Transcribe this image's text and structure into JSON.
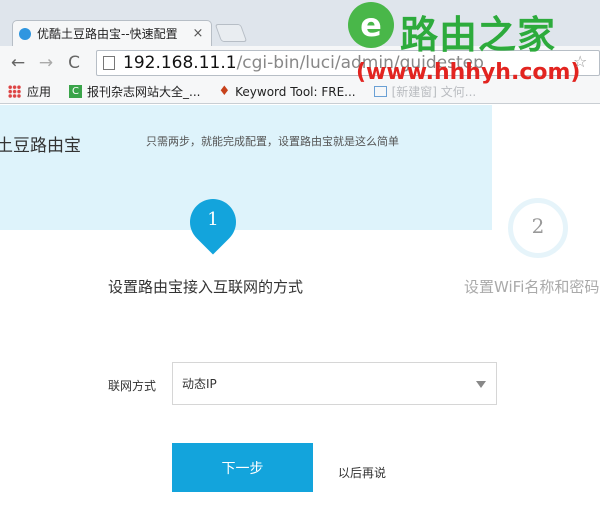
{
  "browser": {
    "tab_title": "优酷土豆路由宝--快速配置",
    "tab_close": "×",
    "address": {
      "host": "192.168.11.1",
      "path": "/cgi-bin/luci/admin/guidestep"
    },
    "nav": {
      "back": "←",
      "forward": "→",
      "reload": "C"
    },
    "bookmarks": [
      {
        "label": "应用",
        "icon": "apps-grid-icon"
      },
      {
        "label": "报刊杂志网站大全_...",
        "icon": "green-g-icon"
      },
      {
        "label": "Keyword Tool: FRE...",
        "icon": "keyword-tool-icon"
      },
      {
        "label": "[新建窗] 文何...",
        "icon": "bookmark-icon"
      }
    ],
    "star": "☆"
  },
  "watermark": {
    "logo_glyph": "e",
    "name": "路由之家",
    "url": "(www.hhhyh.com)"
  },
  "page": {
    "brand": "土豆路由宝",
    "tagline": "只需两步，就能完成配置，设置路由宝就是这么简单",
    "steps": [
      {
        "number": "1",
        "label": "设置路由宝接入互联网的方式",
        "active": true
      },
      {
        "number": "2",
        "label": "设置WiFi名称和密码",
        "active": false
      }
    ],
    "connection_field": {
      "label": "联网方式",
      "value": "动态IP"
    },
    "next_button": "下一步",
    "later_link": "以后再说"
  },
  "colors": {
    "accent": "#13a4dc",
    "hero_bg": "#def3fb",
    "watermark_green": "#2dab3c",
    "watermark_red": "#e22420"
  }
}
